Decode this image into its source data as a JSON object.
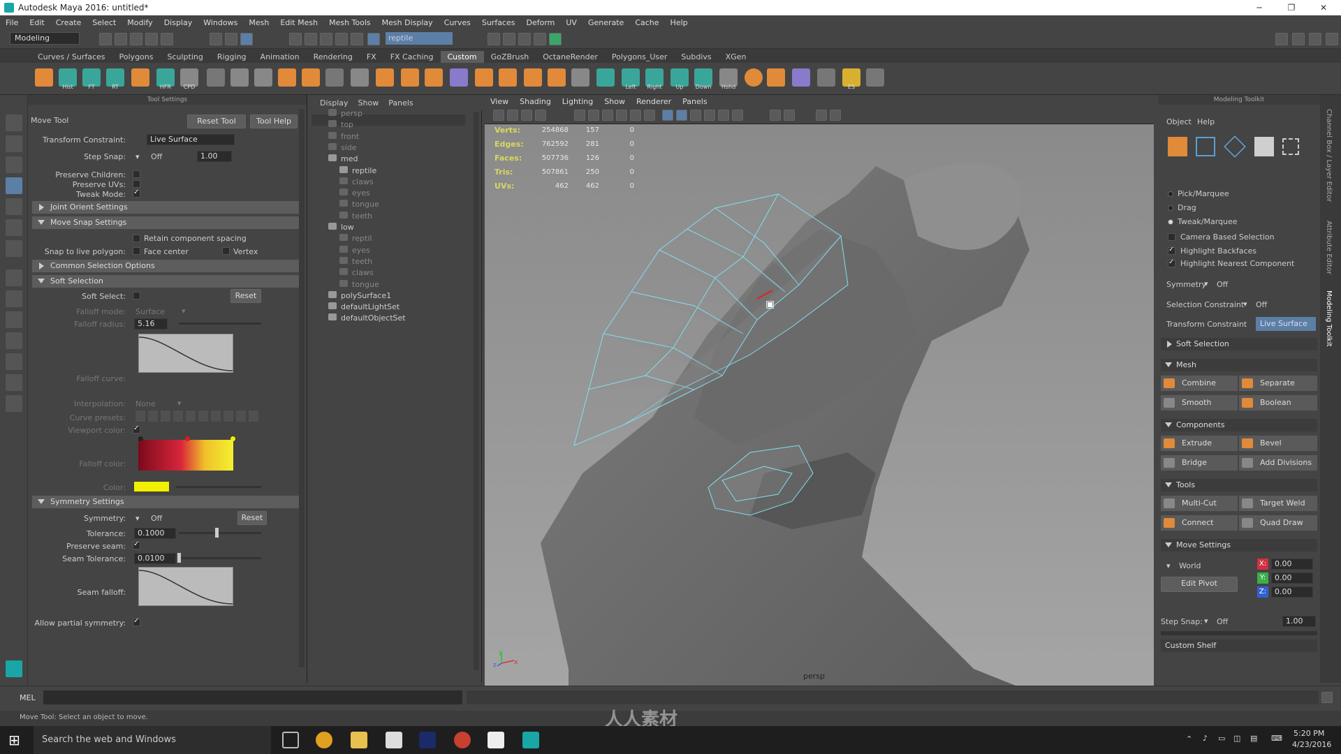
{
  "window": {
    "title": "Autodesk Maya 2016: untitled*",
    "minimize": "─",
    "restore": "❐",
    "close": "✕"
  },
  "menu": [
    "File",
    "Edit",
    "Create",
    "Select",
    "Modify",
    "Display",
    "Windows",
    "Mesh",
    "Edit Mesh",
    "Mesh Tools",
    "Mesh Display",
    "Curves",
    "Surfaces",
    "Deform",
    "UV",
    "Generate",
    "Cache",
    "Help"
  ],
  "status": {
    "mode": "Modeling",
    "search": "reptile"
  },
  "shelf_tabs": [
    "Curves / Surfaces",
    "Polygons",
    "Sculpting",
    "Rigging",
    "Animation",
    "Rendering",
    "FX",
    "FX Caching",
    "Custom",
    "GoZBrush",
    "OctaneRender",
    "Polygons_User",
    "Subdivs",
    "XGen"
  ],
  "shelf_active": "Custom",
  "shelf_labels": {
    "hist": "Hist",
    "ft": "FT",
    "rt": "RT",
    "hfr": "HFR",
    "cpd": "CPD",
    "left": "Left",
    "right": "Right",
    "up": "Up",
    "down": "Down",
    "hshd": "Hshd",
    "es": "ES"
  },
  "tool_settings": {
    "header": "Tool Settings",
    "tool_name": "Move Tool",
    "reset_tool": "Reset Tool",
    "tool_help": "Tool Help",
    "transform_constraint_label": "Transform Constraint:",
    "transform_constraint_value": "Live Surface",
    "step_snap_label": "Step Snap:",
    "step_snap_value": "Off",
    "step_snap_num": "1.00",
    "preserve_children": "Preserve Children:",
    "preserve_uvs": "Preserve UVs:",
    "tweak_mode": "Tweak Mode:",
    "joint_orient": "Joint Orient Settings",
    "move_snap": "Move Snap Settings",
    "retain_spacing": "Retain component spacing",
    "snap_live": "Snap to live polygon:",
    "face_center": "Face center",
    "vertex": "Vertex",
    "common_sel": "Common Selection Options",
    "soft_sel_section": "Soft Selection",
    "soft_select": "Soft Select:",
    "reset": "Reset",
    "falloff_mode_label": "Falloff mode:",
    "falloff_mode_value": "Surface",
    "falloff_radius_label": "Falloff radius:",
    "falloff_radius_value": "5.16",
    "falloff_curve": "Falloff curve:",
    "interpolation_label": "Interpolation:",
    "interpolation_value": "None",
    "curve_presets": "Curve presets:",
    "viewport_color": "Viewport color:",
    "falloff_color": "Falloff color:",
    "color": "Color:",
    "symmetry_section": "Symmetry Settings",
    "symmetry_label": "Symmetry:",
    "symmetry_value": "Off",
    "tolerance_label": "Tolerance:",
    "tolerance_value": "0.1000",
    "preserve_seam": "Preserve seam:",
    "seam_tol_label": "Seam Tolerance:",
    "seam_tol_value": "0.0100",
    "seam_falloff": "Seam falloff:",
    "allow_partial": "Allow partial symmetry:"
  },
  "outliner": {
    "menu": [
      "Display",
      "Show",
      "Panels"
    ],
    "items": [
      {
        "label": "persp",
        "depth": 1,
        "dim": true
      },
      {
        "label": "top",
        "depth": 1,
        "dim": true
      },
      {
        "label": "front",
        "depth": 1,
        "dim": true
      },
      {
        "label": "side",
        "depth": 1,
        "dim": true
      },
      {
        "label": "med",
        "depth": 1,
        "dim": false
      },
      {
        "label": "reptile",
        "depth": 2,
        "dim": false
      },
      {
        "label": "claws",
        "depth": 2,
        "dim": true
      },
      {
        "label": "eyes",
        "depth": 2,
        "dim": true
      },
      {
        "label": "tongue",
        "depth": 2,
        "dim": true
      },
      {
        "label": "teeth",
        "depth": 2,
        "dim": true
      },
      {
        "label": "low",
        "depth": 1,
        "dim": false
      },
      {
        "label": "reptil",
        "depth": 2,
        "dim": true
      },
      {
        "label": "eyes",
        "depth": 2,
        "dim": true
      },
      {
        "label": "teeth",
        "depth": 2,
        "dim": true
      },
      {
        "label": "claws",
        "depth": 2,
        "dim": true
      },
      {
        "label": "tongue",
        "depth": 2,
        "dim": true
      },
      {
        "label": "polySurface1",
        "depth": 1,
        "dim": false
      },
      {
        "label": "defaultLightSet",
        "depth": 1,
        "dim": false
      },
      {
        "label": "defaultObjectSet",
        "depth": 1,
        "dim": false
      }
    ]
  },
  "viewport": {
    "menu": [
      "View",
      "Shading",
      "Lighting",
      "Show",
      "Renderer",
      "Panels"
    ],
    "camera": "persp",
    "hud": [
      {
        "label": "Verts:",
        "a": "254868",
        "b": "157",
        "c": "0"
      },
      {
        "label": "Edges:",
        "a": "762592",
        "b": "281",
        "c": "0"
      },
      {
        "label": "Faces:",
        "a": "507736",
        "b": "126",
        "c": "0"
      },
      {
        "label": "Tris:",
        "a": "507861",
        "b": "250",
        "c": "0"
      },
      {
        "label": "UVs:",
        "a": "462",
        "b": "462",
        "c": "0"
      }
    ],
    "axis": {
      "x": "x",
      "y": "y",
      "z": "z"
    }
  },
  "toolkit": {
    "header": "Modeling Toolkit",
    "menu": [
      "Object",
      "Help"
    ],
    "pick_marquee": "Pick/Marquee",
    "drag": "Drag",
    "tweak_marquee": "Tweak/Marquee",
    "camera_based": "Camera Based Selection",
    "highlight_backfaces": "Highlight Backfaces",
    "highlight_nearest": "Highlight Nearest Component",
    "symmetry_label": "Symmetry",
    "symmetry_value": "Off",
    "sel_constraint_label": "Selection Constraint",
    "sel_constraint_value": "Off",
    "transform_constraint_label": "Transform Constraint",
    "transform_constraint_value": "Live Surface",
    "soft_selection": "Soft Selection",
    "mesh": "Mesh",
    "combine": "Combine",
    "separate": "Separate",
    "smooth": "Smooth",
    "boolean": "Boolean",
    "components": "Components",
    "extrude": "Extrude",
    "bevel": "Bevel",
    "bridge": "Bridge",
    "add_divisions": "Add Divisions",
    "tools": "Tools",
    "multi_cut": "Multi-Cut",
    "target_weld": "Target Weld",
    "connect": "Connect",
    "quad_draw": "Quad Draw",
    "move_settings": "Move Settings",
    "world": "World",
    "edit_pivot": "Edit Pivot",
    "x": "X:",
    "y": "Y:",
    "z": "Z:",
    "xv": "0.00",
    "yv": "0.00",
    "zv": "0.00",
    "step_snap_label": "Step Snap:",
    "step_snap_value": "Off",
    "step_snap_num": "1.00",
    "custom_shelf": "Custom Shelf"
  },
  "side_tabs": [
    "Channel Box / Layer Editor",
    "Attribute Editor",
    "Modeling Toolkit"
  ],
  "cmd": {
    "mel": "MEL",
    "help": "Move Tool: Select an object to move."
  },
  "taskbar": {
    "search": "Search the web and Windows",
    "time": "5:20 PM",
    "date": "4/23/2016"
  },
  "watermark": "人人素材",
  "colors": {
    "accent": "#5d7fa6",
    "wire": "#7fe0f0",
    "falloff_start": "#8a0a1c",
    "falloff_mid": "#d92a2a",
    "falloff_end": "#f4e430",
    "color_swatch": "#f0f000"
  }
}
